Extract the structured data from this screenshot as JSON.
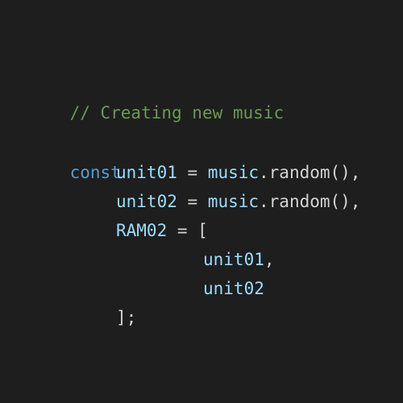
{
  "code": {
    "comment": "// Creating new music",
    "keyword": "const",
    "line_unit01": {
      "var": "unit01",
      "op": " = ",
      "obj": "music",
      "call": ".random(),"
    },
    "line_unit02": {
      "var": "unit02",
      "op": " = ",
      "obj": "music",
      "call": ".random(),"
    },
    "line_ram": {
      "var": "RAM02",
      "op": " = ["
    },
    "array_item_1": {
      "var": "unit01",
      "punct": ","
    },
    "array_item_2": {
      "var": "unit02"
    },
    "closing": "];"
  },
  "colors": {
    "background": "#1e1e1e",
    "comment": "#6a9955",
    "keyword": "#569cd6",
    "variable": "#9cdcfe",
    "text": "#d4d4d4"
  }
}
